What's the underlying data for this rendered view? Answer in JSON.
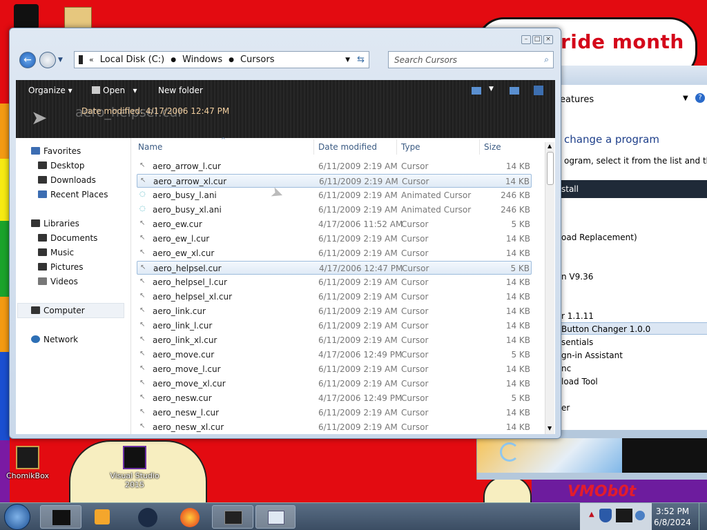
{
  "desktop": {
    "banner_text": "ride month",
    "watermark": "VMOb0t",
    "icons": [
      {
        "label": "ChomikBox"
      },
      {
        "label": "Visual Studio 2015"
      }
    ]
  },
  "background_window": {
    "title": "eatures",
    "heading": "change a program",
    "instruction": "ogram, select it from the list and then c",
    "install_label": "stall",
    "items": [
      "oad Replacement)",
      "n V9.36",
      "r 1.1.11",
      "Button Changer 1.0.0",
      "sentials",
      "gn-in Assistant",
      "nc",
      "load Tool",
      "er"
    ]
  },
  "explorer": {
    "address": {
      "segments": [
        "Local Disk (C:)",
        "Windows",
        "Cursors"
      ]
    },
    "search_placeholder": "Search Cursors",
    "toolbar": {
      "organize": "Organize",
      "open": "Open",
      "new_folder": "New folder"
    },
    "details_pane": {
      "name": "aero_helpsel.cur",
      "meta": "Date modified: 4/17/2006 12:47 PM"
    },
    "nav": {
      "favorites": "Favorites",
      "favorite_items": [
        "Desktop",
        "Downloads",
        "Recent Places"
      ],
      "libraries": "Libraries",
      "library_items": [
        "Documents",
        "Music",
        "Pictures",
        "Videos"
      ],
      "computer": "Computer",
      "network": "Network"
    },
    "columns": {
      "name": "Name",
      "date": "Date modified",
      "type": "Type",
      "size": "Size"
    },
    "files": [
      {
        "name": "aero_arrow_l.cur",
        "date": "6/11/2009 2:19 AM",
        "type": "Cursor",
        "size": "14 KB"
      },
      {
        "name": "aero_arrow_xl.cur",
        "date": "6/11/2009 2:19 AM",
        "type": "Cursor",
        "size": "14 KB"
      },
      {
        "name": "aero_busy_l.ani",
        "date": "6/11/2009 2:19 AM",
        "type": "Animated Cursor",
        "size": "246 KB"
      },
      {
        "name": "aero_busy_xl.ani",
        "date": "6/11/2009 2:19 AM",
        "type": "Animated Cursor",
        "size": "246 KB"
      },
      {
        "name": "aero_ew.cur",
        "date": "4/17/2006 11:52 AM",
        "type": "Cursor",
        "size": "5 KB"
      },
      {
        "name": "aero_ew_l.cur",
        "date": "6/11/2009 2:19 AM",
        "type": "Cursor",
        "size": "14 KB"
      },
      {
        "name": "aero_ew_xl.cur",
        "date": "6/11/2009 2:19 AM",
        "type": "Cursor",
        "size": "14 KB"
      },
      {
        "name": "aero_helpsel.cur",
        "date": "4/17/2006 12:47 PM",
        "type": "Cursor",
        "size": "5 KB"
      },
      {
        "name": "aero_helpsel_l.cur",
        "date": "6/11/2009 2:19 AM",
        "type": "Cursor",
        "size": "14 KB"
      },
      {
        "name": "aero_helpsel_xl.cur",
        "date": "6/11/2009 2:19 AM",
        "type": "Cursor",
        "size": "14 KB"
      },
      {
        "name": "aero_link.cur",
        "date": "6/11/2009 2:19 AM",
        "type": "Cursor",
        "size": "14 KB"
      },
      {
        "name": "aero_link_l.cur",
        "date": "6/11/2009 2:19 AM",
        "type": "Cursor",
        "size": "14 KB"
      },
      {
        "name": "aero_link_xl.cur",
        "date": "6/11/2009 2:19 AM",
        "type": "Cursor",
        "size": "14 KB"
      },
      {
        "name": "aero_move.cur",
        "date": "4/17/2006 12:49 PM",
        "type": "Cursor",
        "size": "5 KB"
      },
      {
        "name": "aero_move_l.cur",
        "date": "6/11/2009 2:19 AM",
        "type": "Cursor",
        "size": "14 KB"
      },
      {
        "name": "aero_move_xl.cur",
        "date": "6/11/2009 2:19 AM",
        "type": "Cursor",
        "size": "14 KB"
      },
      {
        "name": "aero_nesw.cur",
        "date": "4/17/2006 12:49 PM",
        "type": "Cursor",
        "size": "5 KB"
      },
      {
        "name": "aero_nesw_l.cur",
        "date": "6/11/2009 2:19 AM",
        "type": "Cursor",
        "size": "14 KB"
      },
      {
        "name": "aero_nesw_xl.cur",
        "date": "6/11/2009 2:19 AM",
        "type": "Cursor",
        "size": "14 KB"
      }
    ],
    "selected_rows": [
      1,
      7
    ]
  },
  "taskbar": {
    "time": "3:52 PM",
    "date": "6/8/2024"
  },
  "colors": {
    "wallpaper_red": "#e30b11",
    "selection": "#dfeaf6",
    "toolbar_dark": "#232323",
    "column_header": "#3b5b83"
  }
}
